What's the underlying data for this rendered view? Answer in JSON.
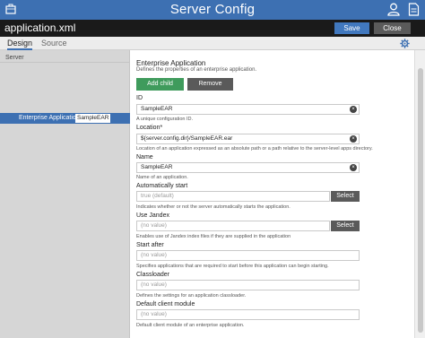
{
  "titlebar": {
    "title": "Server Config",
    "app_icon": "briefcase-icon",
    "user_icon": "user-icon",
    "file_icon": "document-icon"
  },
  "filebar": {
    "filename": "application.xml",
    "save_label": "Save",
    "close_label": "Close"
  },
  "tabs": {
    "design": "Design",
    "source": "Source",
    "settings_icon": "gear-icon"
  },
  "sidebar": {
    "root": "Server",
    "selected": {
      "label": "Enterprise Application",
      "badge": "SampleEAR"
    }
  },
  "main": {
    "section_title": "Enterprise Application",
    "section_desc": "Defines the properties of an enterprise application.",
    "add_child_label": "Add child",
    "remove_label": "Remove",
    "fields": {
      "id": {
        "label": "ID",
        "value": "SampleEAR",
        "help": "A unique configuration ID."
      },
      "location": {
        "label": "Location*",
        "value": "${server.config.dir}/SampleEAR.ear",
        "help": "Location of an application expressed as an absolute path or a path relative to the server-level apps directory."
      },
      "name": {
        "label": "Name",
        "value": "SampleEAR",
        "help": "Name of an application."
      },
      "autostart": {
        "label": "Automatically start",
        "placeholder": "true (default)",
        "button": "Select",
        "help": "Indicates whether or not the server automatically starts the application."
      },
      "jandex": {
        "label": "Use Jandex",
        "placeholder": "(no value)",
        "button": "Select",
        "help": "Enables use of Jandex index files if they are supplied in the application"
      },
      "start_after": {
        "label": "Start after",
        "placeholder": "(no value)",
        "help": "Specifies applications that are required to start before this application can begin starting."
      },
      "classloader": {
        "label": "Classloader",
        "placeholder": "(no value)",
        "help": "Defines the settings for an application classloader."
      },
      "client_module": {
        "label": "Default client module",
        "placeholder": "(no value)",
        "help": "Default client module of an enterprise application."
      }
    }
  },
  "colors": {
    "titlebar": "#3d70b2",
    "filebar": "#1a1a1a",
    "save": "#4178be",
    "add_child": "#3f9b5c",
    "neutral_button": "#5a5a5a",
    "sidebar": "#d6d6d6",
    "selected_row": "#3d70b2"
  }
}
